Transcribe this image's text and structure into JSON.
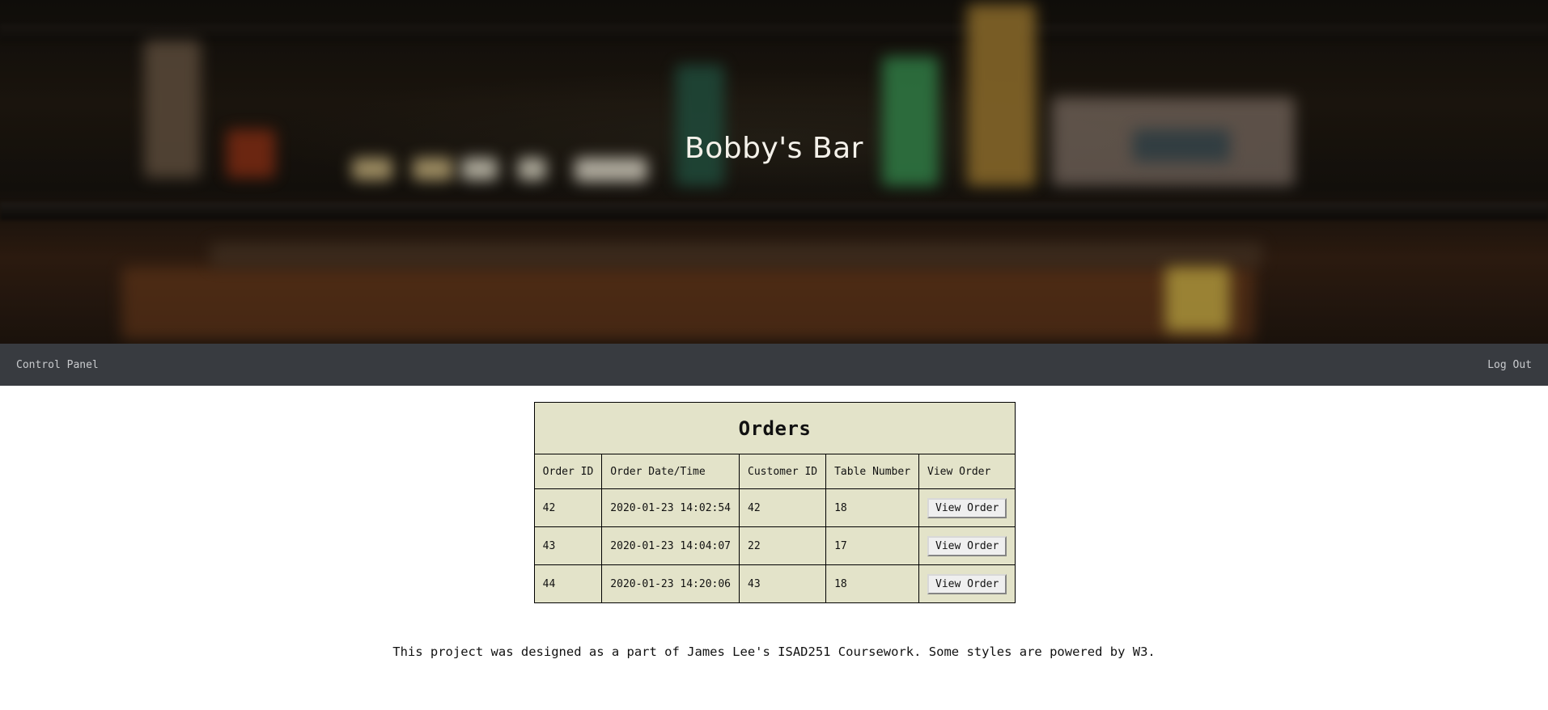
{
  "header": {
    "title": "Bobby's Bar"
  },
  "nav": {
    "left_link": "Control Panel",
    "right_link": "Log Out"
  },
  "orders_table": {
    "title": "Orders",
    "columns": [
      "Order ID",
      "Order Date/Time",
      "Customer ID",
      "Table Number",
      "View Order"
    ],
    "rows": [
      {
        "order_id": "42",
        "datetime": "2020-01-23 14:02:54",
        "customer_id": "42",
        "table_number": "18",
        "action": "View Order"
      },
      {
        "order_id": "43",
        "datetime": "2020-01-23 14:04:07",
        "customer_id": "22",
        "table_number": "17",
        "action": "View Order"
      },
      {
        "order_id": "44",
        "datetime": "2020-01-23 14:20:06",
        "customer_id": "43",
        "table_number": "18",
        "action": "View Order"
      }
    ]
  },
  "footer": {
    "text": "This project was designed as a part of James Lee's ISAD251 Coursework. Some styles are powered by W3."
  },
  "colors": {
    "navbar_bg": "#383b40",
    "table_bg": "#e3e3c9"
  }
}
